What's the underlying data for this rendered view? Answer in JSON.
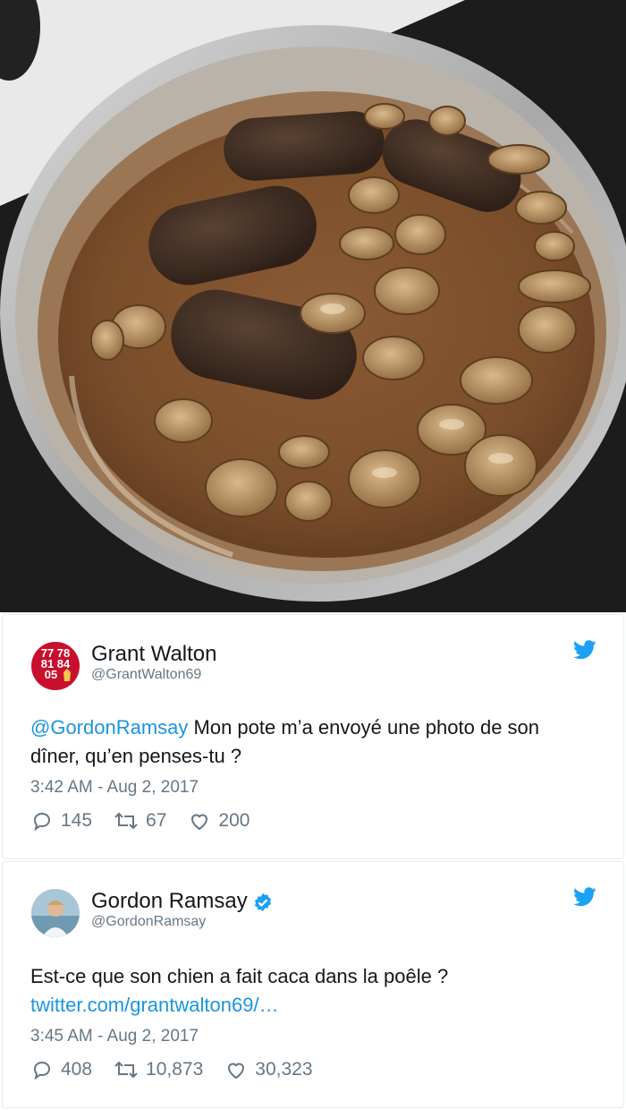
{
  "tweets": [
    {
      "name": "Grant Walton",
      "handle": "@GrantWalton69",
      "mention": "@GordonRamsay",
      "text": " Mon pote m’a envoyé une photo de son dîner, qu’en penses-tu ?",
      "link": "",
      "time": "3:42 AM - Aug 2, 2017",
      "replies": "145",
      "retweets": "67",
      "likes": "200",
      "verified": false,
      "avatar_text": [
        "77 78",
        "81 84",
        "05"
      ]
    },
    {
      "name": "Gordon Ramsay",
      "handle": "@GordonRamsay",
      "mention": "",
      "text": "Est-ce que son chien a fait caca dans la poêle ?",
      "link": "twitter.com/grantwalton69/…",
      "time": "3:45 AM - Aug 2, 2017",
      "replies": "408",
      "retweets": "10,873",
      "likes": "30,323",
      "verified": true
    }
  ],
  "colors": {
    "twitter_blue": "#1da1f2",
    "link": "#1b95e0",
    "muted": "#657786",
    "text": "#14171a",
    "liverpool_red": "#c8102e"
  }
}
